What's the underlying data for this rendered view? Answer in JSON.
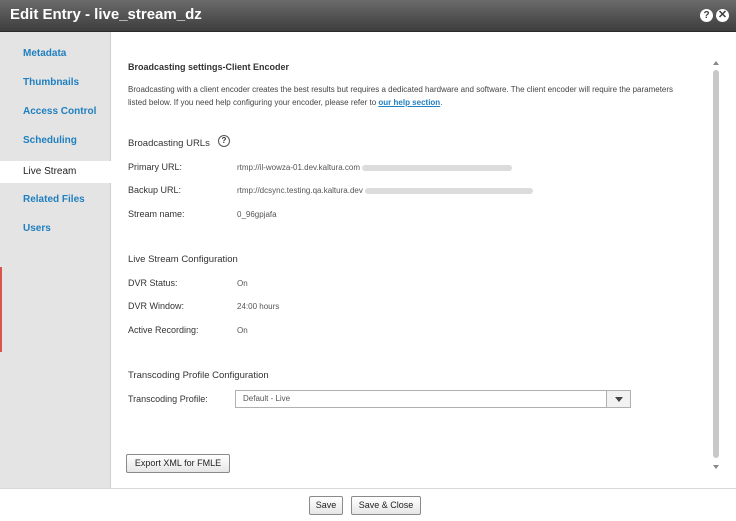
{
  "window": {
    "title": "Edit Entry - live_stream_dz"
  },
  "title_buttons": {
    "help": "?",
    "close": "✕"
  },
  "sidebar": {
    "items": [
      {
        "label": "Metadata"
      },
      {
        "label": "Thumbnails"
      },
      {
        "label": "Access Control"
      },
      {
        "label": "Scheduling"
      },
      {
        "label": "Live Stream",
        "active": true
      },
      {
        "label": "Related Files"
      },
      {
        "label": "Users"
      }
    ]
  },
  "broadcasting": {
    "heading": "Broadcasting settings-Client Encoder",
    "description": "Broadcasting with a client encoder creates the best results but requires a dedicated hardware and software. The client encoder will require the parameters listed below. If you need help configuring your encoder, please refer to",
    "help_link": "our help section",
    "description_end": "."
  },
  "urls": {
    "heading": "Broadcasting URLs",
    "help_icon": "?",
    "primary_label": "Primary URL:",
    "primary_value": "rtmp://il-wowza-01.dev.kaltura.com",
    "backup_label": "Backup URL:",
    "backup_value": "rtmp://dcsync.testing.qa.kaltura.dev",
    "stream_name_label": "Stream name:",
    "stream_name_value": "0_96gpjafa"
  },
  "live_config": {
    "heading": "Live Stream Configuration",
    "dvr_status_label": "DVR Status:",
    "dvr_status_value": "On",
    "dvr_window_label": "DVR Window:",
    "dvr_window_value": "24:00 hours",
    "active_recording_label": "Active Recording:",
    "active_recording_value": "On"
  },
  "transcoding": {
    "heading": "Transcoding Profile Configuration",
    "profile_label": "Transcoding Profile:",
    "profile_value": "Default - Live"
  },
  "buttons": {
    "export_xml": "Export XML for FMLE",
    "save": "Save",
    "save_close": "Save & Close"
  },
  "colors": {
    "title_bar": "#4a4a4a",
    "link": "#1f7fbf",
    "sidebar_bg": "#e4e4e4"
  }
}
